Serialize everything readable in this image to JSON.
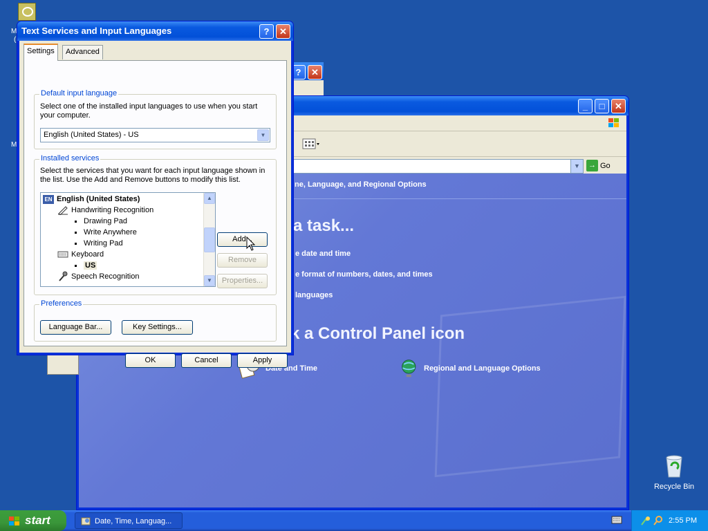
{
  "desktop": {
    "recycle_bin_label": "Recycle Bin",
    "left_fragments": [
      "M",
      "(",
      "M"
    ]
  },
  "control_panel": {
    "breadcrumb": "Date, Time, Language, and Regional Options",
    "breadcrumb_visible": "ne, Language, and Regional Options",
    "go_label": "Go",
    "pick_task_heading": "a task...",
    "tasks": [
      "e date and time",
      "e format of numbers, dates, and times",
      "languages"
    ],
    "pick_icon_heading": "k a Control Panel icon",
    "icons": [
      {
        "label": "Date and Time",
        "icon": "clock-calendar-icon"
      },
      {
        "label": "Regional and Language Options",
        "icon": "globe-icon"
      }
    ]
  },
  "dialog": {
    "title": "Text Services and Input Languages",
    "tabs": [
      "Settings",
      "Advanced"
    ],
    "active_tab": "Settings",
    "default_lang": {
      "legend": "Default input language",
      "description": "Select one of the installed input languages to use when you start your computer.",
      "selected": "English (United States) - US"
    },
    "installed": {
      "legend": "Installed services",
      "description": "Select the services that you want for each input language shown in the list. Use the Add and Remove buttons to modify this list.",
      "tree": [
        {
          "level": 0,
          "text": "English (United States)",
          "bold": true,
          "icon": "en-language-badge",
          "badge": "EN"
        },
        {
          "level": 1,
          "text": "Handwriting Recognition",
          "icon": "pen-icon"
        },
        {
          "level": 2,
          "text": "Drawing Pad"
        },
        {
          "level": 2,
          "text": "Write Anywhere"
        },
        {
          "level": 2,
          "text": "Writing Pad"
        },
        {
          "level": 1,
          "text": "Keyboard",
          "icon": "keyboard-icon"
        },
        {
          "level": 2,
          "text": "US",
          "bold": true,
          "selected": true
        },
        {
          "level": 1,
          "text": "Speech Recognition",
          "icon": "microphone-icon"
        }
      ],
      "add_label": "Add...",
      "remove_label": "Remove",
      "properties_label": "Properties..."
    },
    "preferences": {
      "legend": "Preferences",
      "language_bar_label": "Language Bar...",
      "key_settings_label": "Key Settings..."
    },
    "ok_label": "OK",
    "cancel_label": "Cancel",
    "apply_label": "Apply"
  },
  "taskbar": {
    "start_label": "start",
    "task_label": "Date, Time, Languag...",
    "clock": "2:55 PM"
  },
  "colors": {
    "desktop": "#1d54a8",
    "title_bar": "#0250d8",
    "dialog_face": "#ece9d8",
    "cp_content": "#6378d6",
    "start_green": "#3a963a"
  }
}
